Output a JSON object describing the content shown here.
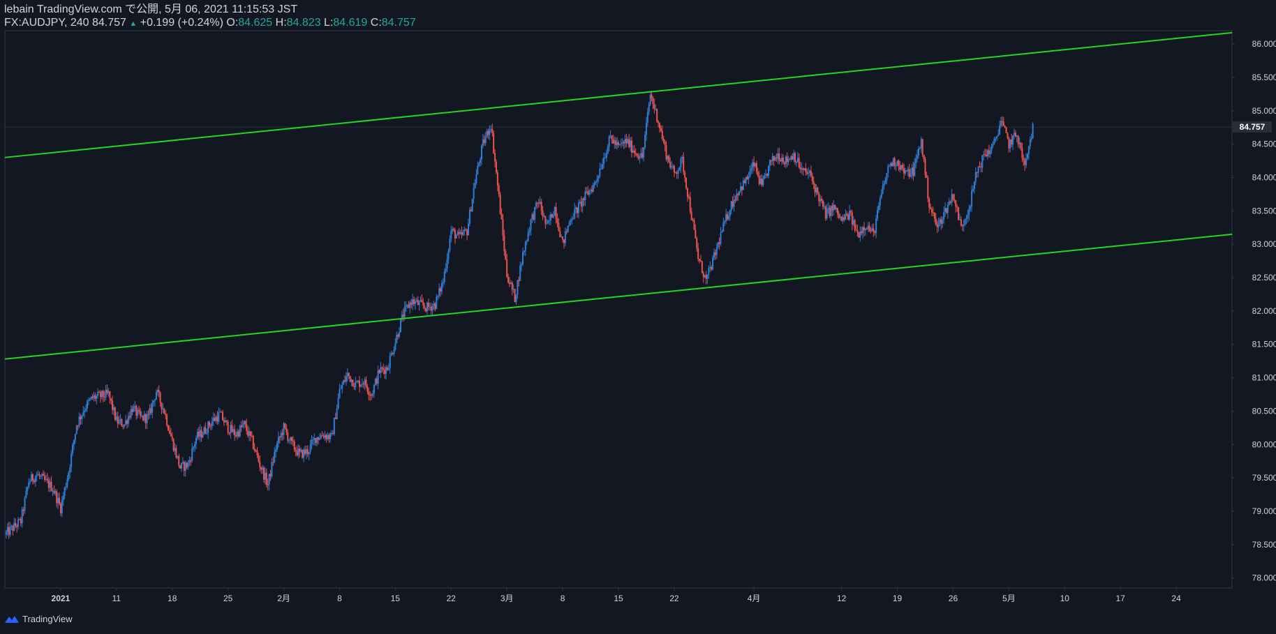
{
  "header": {
    "publish_line": "lebain TradingView.com で公開, 5月 06, 2021 11:15:53 JST",
    "symbol_line": "FX:AUDJPY, 240 84.757",
    "change": "+0.199 (+0.24%)",
    "ohlc": [
      {
        "label": "O:",
        "value": "84.625"
      },
      {
        "label": "H:",
        "value": "84.823"
      },
      {
        "label": "L:",
        "value": "84.619"
      },
      {
        "label": "C:",
        "value": "84.757"
      }
    ]
  },
  "footer": {
    "brand": "TradingView"
  },
  "colors": {
    "background": "#131722",
    "up": "#2e7fd6",
    "down": "#ef5350",
    "channel": "#22d822",
    "axis_text": "#d1d4dc",
    "grid_border": "#363a45"
  },
  "chart_data": {
    "type": "candlestick",
    "symbol": "FX:AUDJPY",
    "timeframe": "240",
    "last_price": 84.757,
    "ylim": [
      77.85,
      86.2
    ],
    "y_ticks": [
      78.0,
      78.5,
      79.0,
      79.5,
      80.0,
      80.5,
      81.0,
      81.5,
      82.0,
      82.5,
      83.0,
      83.5,
      84.0,
      84.5,
      85.0,
      85.5,
      86.0
    ],
    "y_tick_labels": [
      "78.000",
      "78.500",
      "79.000",
      "79.500",
      "80.000",
      "80.500",
      "81.000",
      "81.500",
      "82.000",
      "82.500",
      "83.000",
      "83.500",
      "84.000",
      "84.500",
      "85.000",
      "85.500",
      "86.000"
    ],
    "x_range": [
      "2020-12-28",
      "2021-05-31"
    ],
    "x_ticks": [
      {
        "date": "2021-01-04",
        "label": "2021"
      },
      {
        "date": "2021-01-11",
        "label": "11"
      },
      {
        "date": "2021-01-18",
        "label": "18"
      },
      {
        "date": "2021-01-25",
        "label": "25"
      },
      {
        "date": "2021-02-01",
        "label": "2月"
      },
      {
        "date": "2021-02-08",
        "label": "8"
      },
      {
        "date": "2021-02-15",
        "label": "15"
      },
      {
        "date": "2021-02-22",
        "label": "22"
      },
      {
        "date": "2021-03-01",
        "label": "3月"
      },
      {
        "date": "2021-03-08",
        "label": "8"
      },
      {
        "date": "2021-03-15",
        "label": "15"
      },
      {
        "date": "2021-03-22",
        "label": "22"
      },
      {
        "date": "2021-04-01",
        "label": "4月"
      },
      {
        "date": "2021-04-12",
        "label": "12"
      },
      {
        "date": "2021-04-19",
        "label": "19"
      },
      {
        "date": "2021-04-26",
        "label": "26"
      },
      {
        "date": "2021-05-03",
        "label": "5月"
      },
      {
        "date": "2021-05-10",
        "label": "10"
      },
      {
        "date": "2021-05-17",
        "label": "17"
      },
      {
        "date": "2021-05-24",
        "label": "24"
      }
    ],
    "channel_lines": [
      {
        "name": "upper",
        "from": {
          "date": "2020-12-28",
          "price": 84.3
        },
        "to": {
          "date": "2021-05-31",
          "price": 86.17
        }
      },
      {
        "name": "lower",
        "from": {
          "date": "2020-12-28",
          "price": 81.28
        },
        "to": {
          "date": "2021-05-31",
          "price": 83.15
        }
      }
    ],
    "close_path": [
      [
        "2020-12-28",
        78.65
      ],
      [
        "2020-12-30",
        78.85
      ],
      [
        "2020-12-31",
        79.45
      ],
      [
        "2021-01-01",
        79.55
      ],
      [
        "2021-01-03",
        79.35
      ],
      [
        "2021-01-04",
        79.05
      ],
      [
        "2021-01-05",
        79.6
      ],
      [
        "2021-01-06",
        80.3
      ],
      [
        "2021-01-07",
        80.55
      ],
      [
        "2021-01-08",
        80.7
      ],
      [
        "2021-01-10",
        80.75
      ],
      [
        "2021-01-11",
        80.35
      ],
      [
        "2021-01-12",
        80.3
      ],
      [
        "2021-01-13",
        80.55
      ],
      [
        "2021-01-14",
        80.4
      ],
      [
        "2021-01-15",
        80.4
      ],
      [
        "2021-01-16",
        80.8
      ],
      [
        "2021-01-17",
        80.5
      ],
      [
        "2021-01-18",
        80.05
      ],
      [
        "2021-01-19",
        79.65
      ],
      [
        "2021-01-20",
        79.7
      ],
      [
        "2021-01-21",
        80.1
      ],
      [
        "2021-01-22",
        80.2
      ],
      [
        "2021-01-23",
        80.35
      ],
      [
        "2021-01-24",
        80.45
      ],
      [
        "2021-01-25",
        80.25
      ],
      [
        "2021-01-26",
        80.15
      ],
      [
        "2021-01-27",
        80.3
      ],
      [
        "2021-01-28",
        80.05
      ],
      [
        "2021-01-29",
        79.7
      ],
      [
        "2021-01-30",
        79.4
      ],
      [
        "2021-01-31",
        79.95
      ],
      [
        "2021-02-01",
        80.25
      ],
      [
        "2021-02-02",
        80.0
      ],
      [
        "2021-02-03",
        79.85
      ],
      [
        "2021-02-04",
        79.9
      ],
      [
        "2021-02-05",
        80.1
      ],
      [
        "2021-02-06",
        80.15
      ],
      [
        "2021-02-07",
        80.1
      ],
      [
        "2021-02-08",
        80.8
      ],
      [
        "2021-02-09",
        81.05
      ],
      [
        "2021-02-10",
        80.9
      ],
      [
        "2021-02-11",
        80.95
      ],
      [
        "2021-02-12",
        80.75
      ],
      [
        "2021-02-13",
        81.1
      ],
      [
        "2021-02-14",
        81.15
      ],
      [
        "2021-02-15",
        81.55
      ],
      [
        "2021-02-16",
        81.95
      ],
      [
        "2021-02-17",
        82.15
      ],
      [
        "2021-02-18",
        82.1
      ],
      [
        "2021-02-19",
        82.05
      ],
      [
        "2021-02-20",
        82.1
      ],
      [
        "2021-02-21",
        82.45
      ],
      [
        "2021-02-22",
        83.2
      ],
      [
        "2021-02-23",
        83.1
      ],
      [
        "2021-02-24",
        83.2
      ],
      [
        "2021-02-25",
        83.95
      ],
      [
        "2021-02-26",
        84.5
      ],
      [
        "2021-02-27",
        84.8
      ],
      [
        "2021-02-28",
        83.7
      ],
      [
        "2021-03-01",
        82.55
      ],
      [
        "2021-03-02",
        82.2
      ],
      [
        "2021-03-03",
        82.85
      ],
      [
        "2021-03-04",
        83.35
      ],
      [
        "2021-03-05",
        83.65
      ],
      [
        "2021-03-06",
        83.25
      ],
      [
        "2021-03-07",
        83.55
      ],
      [
        "2021-03-08",
        83.0
      ],
      [
        "2021-03-09",
        83.4
      ],
      [
        "2021-03-10",
        83.55
      ],
      [
        "2021-03-11",
        83.75
      ],
      [
        "2021-03-12",
        83.9
      ],
      [
        "2021-03-13",
        84.25
      ],
      [
        "2021-03-14",
        84.6
      ],
      [
        "2021-03-15",
        84.45
      ],
      [
        "2021-03-16",
        84.55
      ],
      [
        "2021-03-17",
        84.4
      ],
      [
        "2021-03-18",
        84.3
      ],
      [
        "2021-03-19",
        85.25
      ],
      [
        "2021-03-20",
        84.85
      ],
      [
        "2021-03-21",
        84.35
      ],
      [
        "2021-03-22",
        84.05
      ],
      [
        "2021-03-23",
        84.25
      ],
      [
        "2021-03-24",
        83.55
      ],
      [
        "2021-03-25",
        82.8
      ],
      [
        "2021-03-26",
        82.45
      ],
      [
        "2021-03-27",
        82.8
      ],
      [
        "2021-03-28",
        83.2
      ],
      [
        "2021-03-29",
        83.55
      ],
      [
        "2021-03-30",
        83.8
      ],
      [
        "2021-03-31",
        83.95
      ],
      [
        "2021-04-01",
        84.2
      ],
      [
        "2021-04-02",
        83.85
      ],
      [
        "2021-04-03",
        84.2
      ],
      [
        "2021-04-04",
        84.35
      ],
      [
        "2021-04-05",
        84.25
      ],
      [
        "2021-04-06",
        84.35
      ],
      [
        "2021-04-07",
        84.1
      ],
      [
        "2021-04-08",
        84.05
      ],
      [
        "2021-04-09",
        83.75
      ],
      [
        "2021-04-10",
        83.45
      ],
      [
        "2021-04-11",
        83.55
      ],
      [
        "2021-04-12",
        83.35
      ],
      [
        "2021-04-13",
        83.45
      ],
      [
        "2021-04-14",
        83.15
      ],
      [
        "2021-04-15",
        83.3
      ],
      [
        "2021-04-16",
        83.15
      ],
      [
        "2021-04-17",
        83.75
      ],
      [
        "2021-04-18",
        84.2
      ],
      [
        "2021-04-19",
        84.25
      ],
      [
        "2021-04-20",
        84.05
      ],
      [
        "2021-04-21",
        84.1
      ],
      [
        "2021-04-22",
        84.55
      ],
      [
        "2021-04-23",
        83.6
      ],
      [
        "2021-04-24",
        83.25
      ],
      [
        "2021-04-25",
        83.5
      ],
      [
        "2021-04-26",
        83.75
      ],
      [
        "2021-04-27",
        83.25
      ],
      [
        "2021-04-28",
        83.55
      ],
      [
        "2021-04-29",
        84.1
      ],
      [
        "2021-04-30",
        84.35
      ],
      [
        "2021-05-01",
        84.45
      ],
      [
        "2021-05-02",
        84.85
      ],
      [
        "2021-05-03",
        84.5
      ],
      [
        "2021-05-04",
        84.65
      ],
      [
        "2021-05-05",
        84.15
      ],
      [
        "2021-05-06",
        84.757
      ]
    ],
    "intraday_high": 85.45,
    "intraday_low": 78.6
  }
}
